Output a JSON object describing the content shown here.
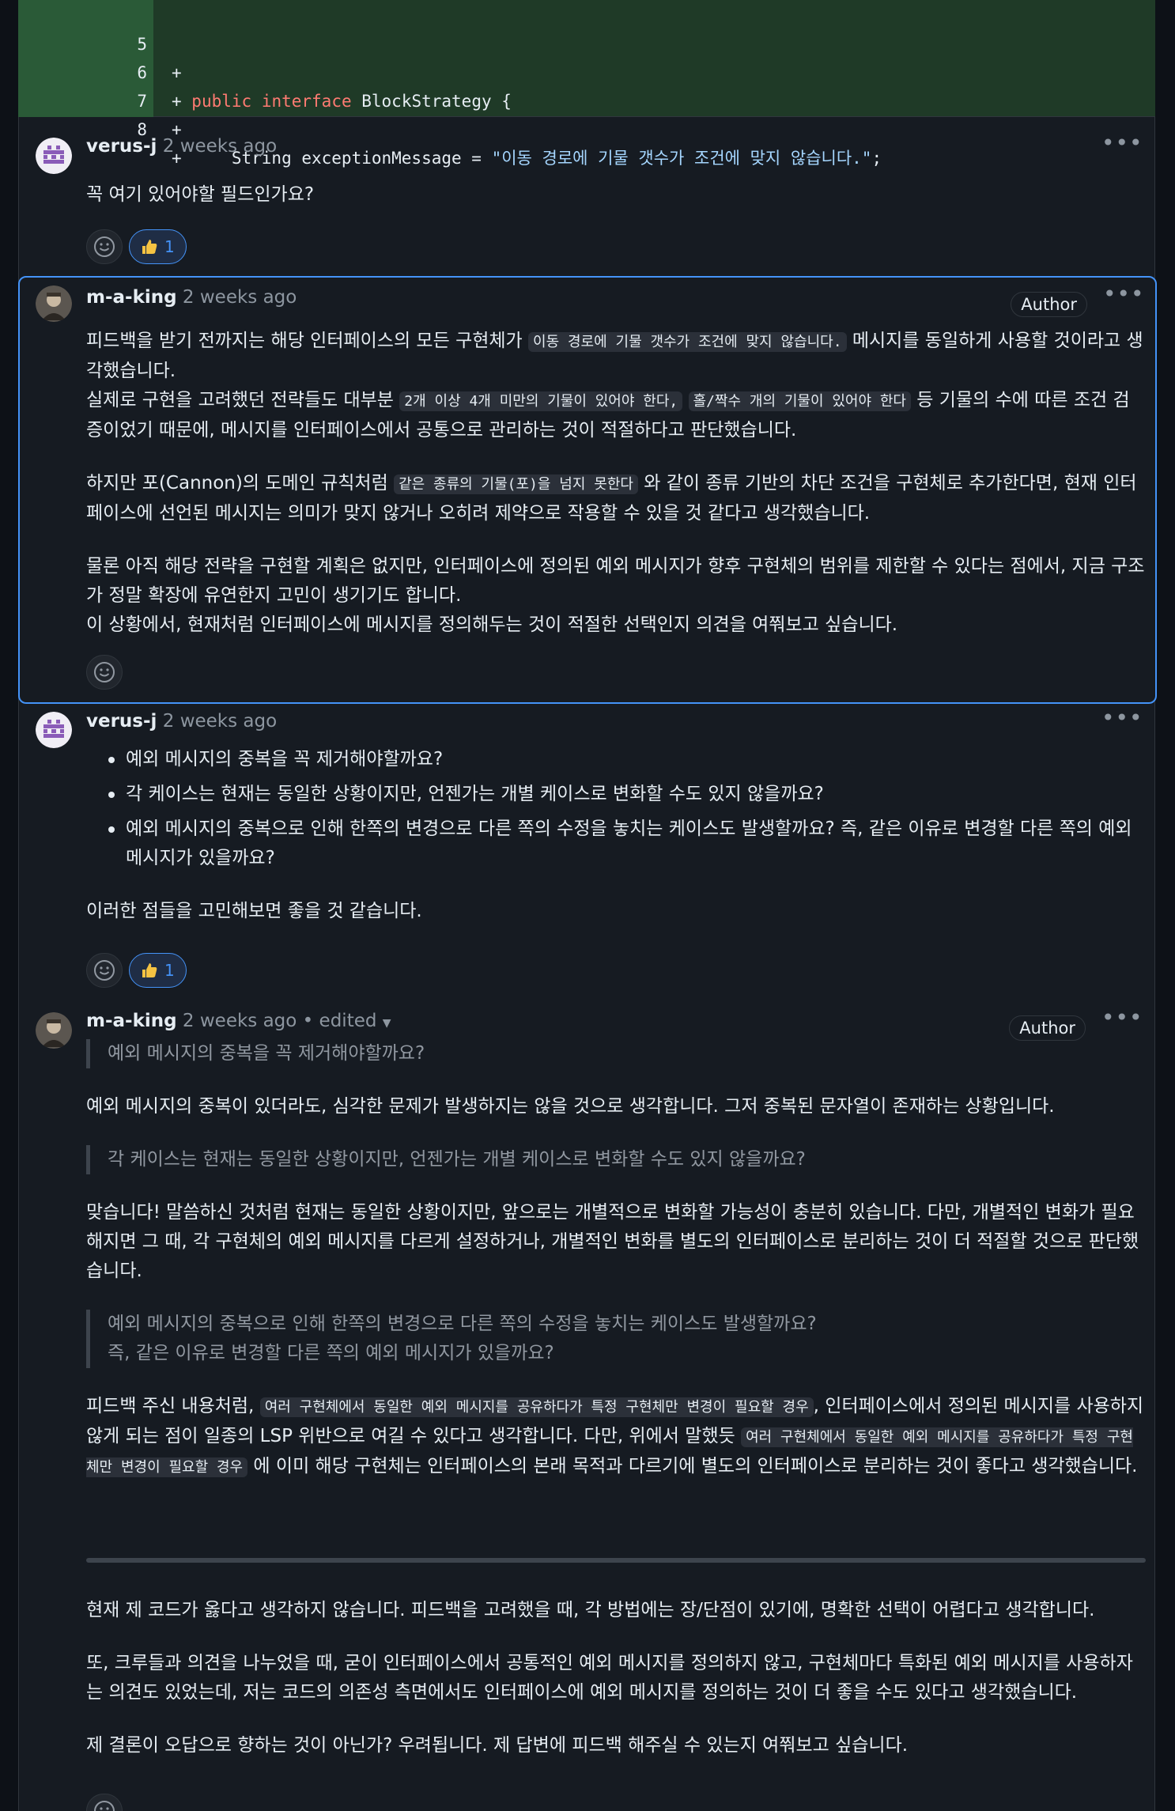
{
  "diff": {
    "lines": [
      {
        "num": "5",
        "code": "+"
      },
      {
        "num": "6",
        "code_prefix": "+ ",
        "kw1": "public",
        "kw2": "interface",
        "code_rest": " BlockStrategy {"
      },
      {
        "num": "7",
        "code": "+"
      },
      {
        "num": "8",
        "code_prefix": "+     String exceptionMessage = ",
        "str": "\"이동 경로에 기물 갯수가 조건에 맞지 않습니다.\"",
        "code_rest": ";"
      }
    ]
  },
  "comments": [
    {
      "author": "verus-j",
      "time": "2 weeks ago",
      "body": "꼭 여기 있어야할 필드인가요?",
      "reaction_count": "1"
    },
    {
      "author": "m-a-king",
      "time": "2 weeks ago",
      "badge": "Author",
      "p1a": "피드백을 받기 전까지는 해당 인터페이스의 모든 구현체가 ",
      "p1code": "이동 경로에 기물 갯수가 조건에 맞지 않습니다.",
      "p1b": " 메시지를 동일하게 사용할 것이라고 생각했습니다.",
      "p2a": "실제로 구현을 고려했던 전략들도 대부분 ",
      "p2code1": "2개 이상 4개 미만의 기물이 있어야 한다,",
      "p2code2": "홀/짝수 개의 기물이 있어야 한다",
      "p2b": " 등 기물의 수에 따른 조건 검증이었기 때문에, 메시지를 인터페이스에서 공통으로 관리하는 것이 적절하다고 판단했습니다.",
      "p3a": "하지만 포(Cannon)의 도메인 규칙처럼 ",
      "p3code": "같은 종류의 기물(포)을 넘지 못한다",
      "p3b": " 와 같이 종류 기반의 차단 조건을 구현체로 추가한다면, 현재 인터페이스에 선언된 메시지는 의미가 맞지 않거나 오히려 제약으로 작용할 수 있을 것 같다고 생각했습니다.",
      "p4": "물론 아직 해당 전략을 구현할 계획은 없지만, 인터페이스에 정의된 예외 메시지가 향후 구현체의 범위를 제한할 수 있다는 점에서, 지금 구조가 정말 확장에 유연한지 고민이 생기기도 합니다.",
      "p5": "이 상황에서, 현재처럼 인터페이스에 메시지를 정의해두는 것이 적절한 선택인지 의견을 여쭤보고 싶습니다."
    },
    {
      "author": "verus-j",
      "time": "2 weeks ago",
      "bullets": [
        "예외 메시지의 중복을 꼭 제거해야할까요?",
        "각 케이스는 현재는 동일한 상황이지만, 언젠가는 개별 케이스로 변화할 수도 있지 않을까요?",
        "예외 메시지의 중복으로 인해 한쪽의 변경으로 다른 쪽의 수정을 놓치는 케이스도 발생할까요? 즉, 같은 이유로 변경할 다른 쪽의 예외 메시지가 있을까요?"
      ],
      "closing": "이러한 점들을 고민해보면 좋을 것 같습니다.",
      "reaction_count": "1"
    },
    {
      "author": "m-a-king",
      "time": "2 weeks ago",
      "edited": "• edited",
      "badge": "Author",
      "q1": "예외 메시지의 중복을 꼭 제거해야할까요?",
      "a1": "예외 메시지의 중복이 있더라도, 심각한 문제가 발생하지는 않을 것으로 생각합니다. 그저 중복된 문자열이 존재하는 상황입니다.",
      "q2": "각 케이스는 현재는 동일한 상황이지만, 언젠가는 개별 케이스로 변화할 수도 있지 않을까요?",
      "a2": "맞습니다! 말씀하신 것처럼 현재는 동일한 상황이지만, 앞으로는 개별적으로 변화할 가능성이 충분히 있습니다. 다만, 개별적인 변화가 필요해지면 그 때, 각 구현체의 예외 메시지를 다르게 설정하거나, 개별적인 변화를 별도의 인터페이스로 분리하는 것이 더 적절할 것으로 판단했습니다.",
      "q3a": "예외 메시지의 중복으로 인해 한쪽의 변경으로 다른 쪽의 수정을 놓치는 케이스도 발생할까요?",
      "q3b": "즉, 같은 이유로 변경할 다른 쪽의 예외 메시지가 있을까요?",
      "a3a": "피드백 주신 내용처럼, ",
      "a3code1": "여러 구현체에서 동일한 예외 메시지를 공유하다가 특정 구현체만 변경이 필요할 경우",
      "a3b": ", 인터페이스에서 정의된 메시지를 사용하지 않게 되는 점이 일종의 LSP 위반으로 여길 수 있다고 생각합니다. 다만, 위에서 말했듯 ",
      "a3code2": "여러 구현체에서 동일한 예외 메시지를 공유하다가 특정 구현체만 변경이 필요할 경우",
      "a3c": " 에 이미 해당 구현체는 인터페이스의 본래 목적과 다르기에 별도의 인터페이스로 분리하는 것이 좋다고 생각했습니다.",
      "b1": "현재 제 코드가 옳다고 생각하지 않습니다. 피드백을 고려했을 때, 각 방법에는 장/단점이 있기에, 명확한 선택이 어렵다고 생각합니다.",
      "b2": "또, 크루들과 의견을 나누었을 때, 굳이 인터페이스에서 공통적인 예외 메시지를 정의하지 않고, 구현체마다 특화된 예외 메시지를 사용하자는 의견도 있었는데, 저는 코드의 의존성 측면에서도 인터페이스에 예외 메시지를 정의하는 것이 더 좋을 수도 있다고 생각했습니다.",
      "b3": "제 결론이 오답으로 향하는 것이 아닌가? 우려됩니다. 제 답변에 피드백 해주실 수 있는지 여쭤보고 싶습니다."
    }
  ]
}
